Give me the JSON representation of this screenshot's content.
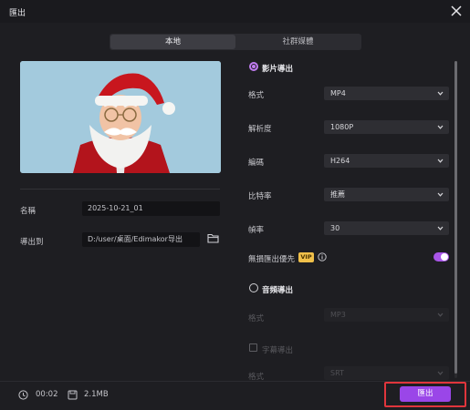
{
  "window": {
    "title": "匯出"
  },
  "tabs": [
    {
      "label": "本地",
      "active": true
    },
    {
      "label": "社群媒體",
      "active": false
    }
  ],
  "left": {
    "name_label": "名稱",
    "name_value": "2025-10-21_01",
    "path_label": "導出到",
    "path_value": "D:/user/桌面/Edimakor导出"
  },
  "video_export": {
    "title": "影片導出",
    "checked": true,
    "format_label": "格式",
    "format_value": "MP4",
    "resolution_label": "解析度",
    "resolution_value": "1080P",
    "codec_label": "編碼",
    "codec_value": "H264",
    "bitrate_label": "比特率",
    "bitrate_value": "推薦",
    "framerate_label": "幀率",
    "framerate_value": "30",
    "lossless_label": "無損匯出優先",
    "vip_badge": "VIP",
    "lossless_enabled": true
  },
  "audio_export": {
    "title": "音頻導出",
    "checked": false,
    "format_label": "格式",
    "format_value": "MP3"
  },
  "subtitle_export": {
    "label": "字幕導出",
    "checked": false,
    "format_label": "格式",
    "format_value": "SRT"
  },
  "footer": {
    "duration": "00:02",
    "size": "2.1MB",
    "export_button": "匯出"
  },
  "colors": {
    "accent": "#9a46e8",
    "highlight_border": "#e0353c",
    "vip": "#f0c04a",
    "background": "#1e1e22"
  },
  "icons": [
    "close-icon",
    "folder-icon",
    "info-icon",
    "clock-icon",
    "file-size-icon",
    "chevron-down-icon"
  ]
}
